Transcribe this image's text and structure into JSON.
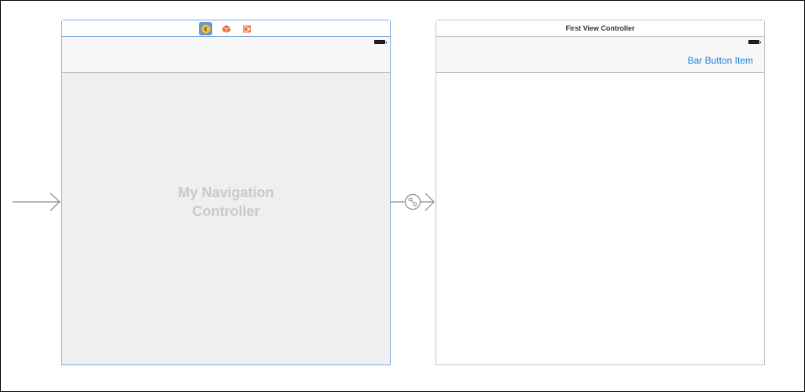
{
  "navigation_controller": {
    "label_line1": "My Navigation",
    "label_line2": "Controller",
    "dock_icons": [
      "back-chevron-icon",
      "cube-icon",
      "exit-icon"
    ]
  },
  "first_view_controller": {
    "title": "First View Controller",
    "bar_button_item": "Bar Button Item"
  },
  "colors": {
    "selection_border": "#7fa8df",
    "bar_button_tint": "#1f7fd6",
    "nav_placeholder_text": "#c9c9c9"
  }
}
